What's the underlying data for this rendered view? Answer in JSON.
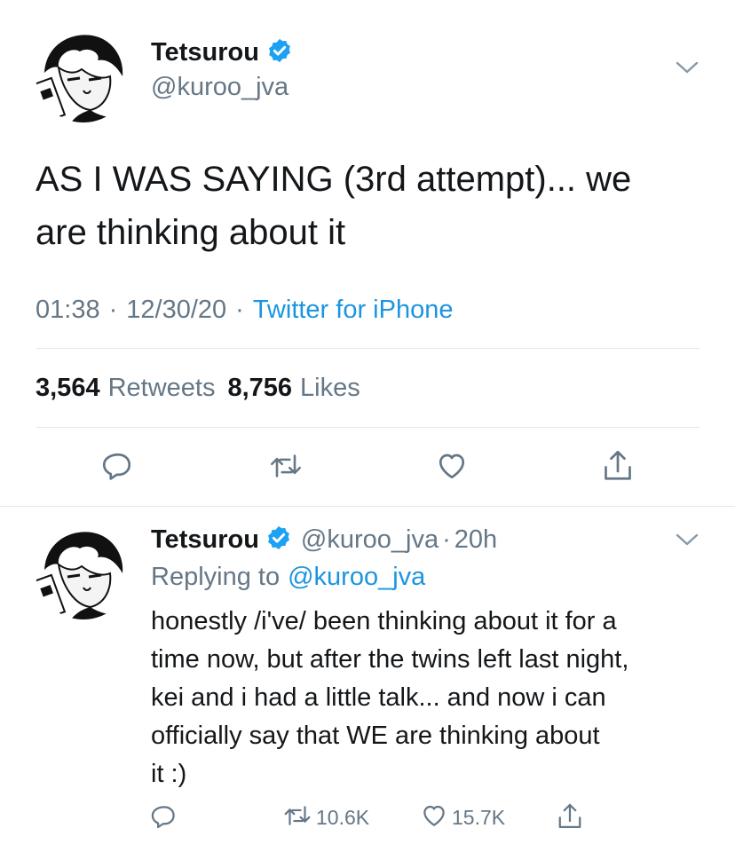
{
  "main_tweet": {
    "author_name": "Tetsurou",
    "author_handle": "@kuroo_jva",
    "text_line1": "AS I WAS SAYING (3rd attempt)... we",
    "text_line2": "are thinking about it",
    "time": "01:38",
    "date": "12/30/20",
    "source": "Twitter for iPhone",
    "retweets_count": "3,564",
    "retweets_label": "Retweets",
    "likes_count": "8,756",
    "likes_label": "Likes"
  },
  "reply_tweet": {
    "author_name": "Tetsurou",
    "author_handle": "@kuroo_jva",
    "age": "20h",
    "replying_prefix": "Replying to",
    "replying_handle": "@kuroo_jva",
    "text_lines": [
      "honestly /i've/ been thinking about it for a",
      "time now, but after the twins left last night,",
      "kei and i had a little talk... and now i can",
      "officially say that WE are thinking about",
      "it :)"
    ],
    "retweet_count": "10.6K",
    "like_count": "15.7K"
  },
  "colors": {
    "verified": "#1da1f2",
    "link": "#1b95e0",
    "muted": "#657786",
    "divider": "#e1e8ed"
  },
  "icons": [
    "verified-icon",
    "chevron-down-icon",
    "reply-icon",
    "retweet-icon",
    "like-icon",
    "share-icon"
  ]
}
